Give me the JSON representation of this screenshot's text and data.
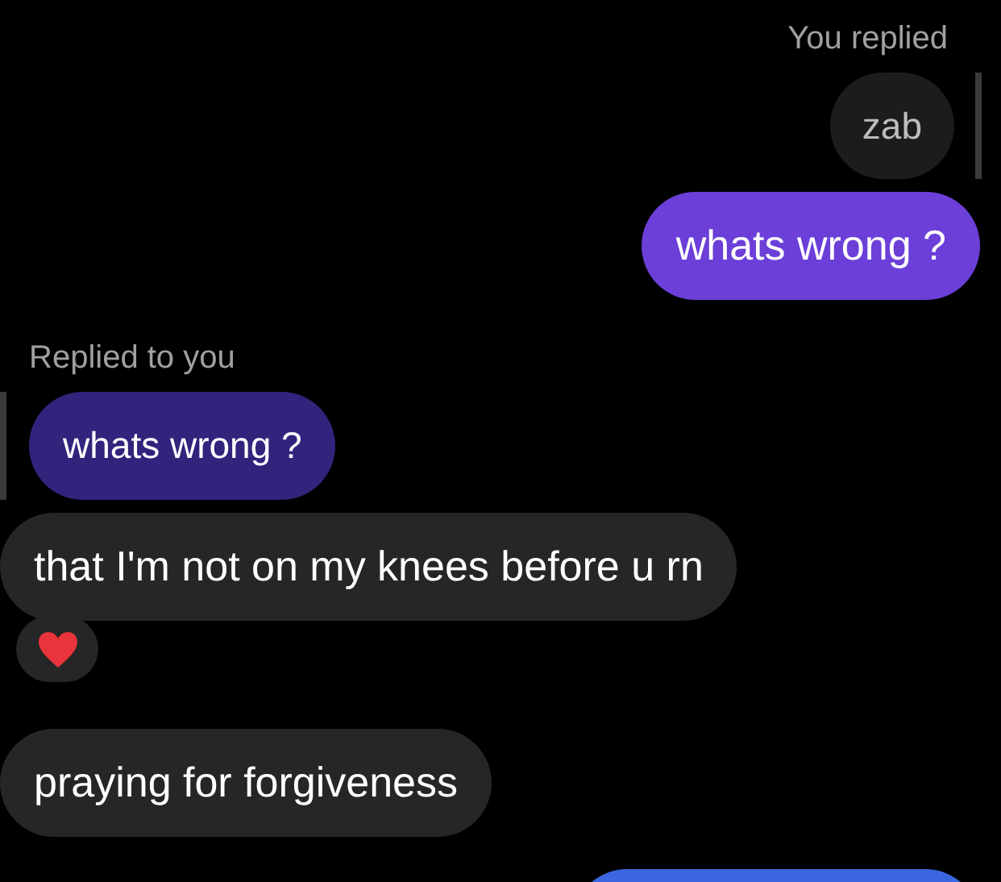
{
  "messages": [
    {
      "kind": "reply_label",
      "outgoing": true,
      "text": "You replied"
    },
    {
      "kind": "quoted",
      "outgoing": true,
      "text": "zab",
      "color": "#1c1c1c"
    },
    {
      "kind": "message",
      "outgoing": true,
      "text": "whats wrong ?",
      "color": "#6b3fd8",
      "reacted": false
    },
    {
      "kind": "reply_label",
      "outgoing": false,
      "text": "Replied to you"
    },
    {
      "kind": "quoted",
      "outgoing": false,
      "text": "whats wrong ?",
      "color": "#33237c"
    },
    {
      "kind": "message",
      "outgoing": false,
      "text": "that I'm not on my knees before u rn",
      "color": "#262626",
      "reacted": true
    },
    {
      "kind": "message",
      "outgoing": false,
      "text": "praying for forgiveness",
      "color": "#262626",
      "reacted": false
    },
    {
      "kind": "cut_off_bubble",
      "outgoing": true,
      "color": "#3b66e0"
    }
  ]
}
